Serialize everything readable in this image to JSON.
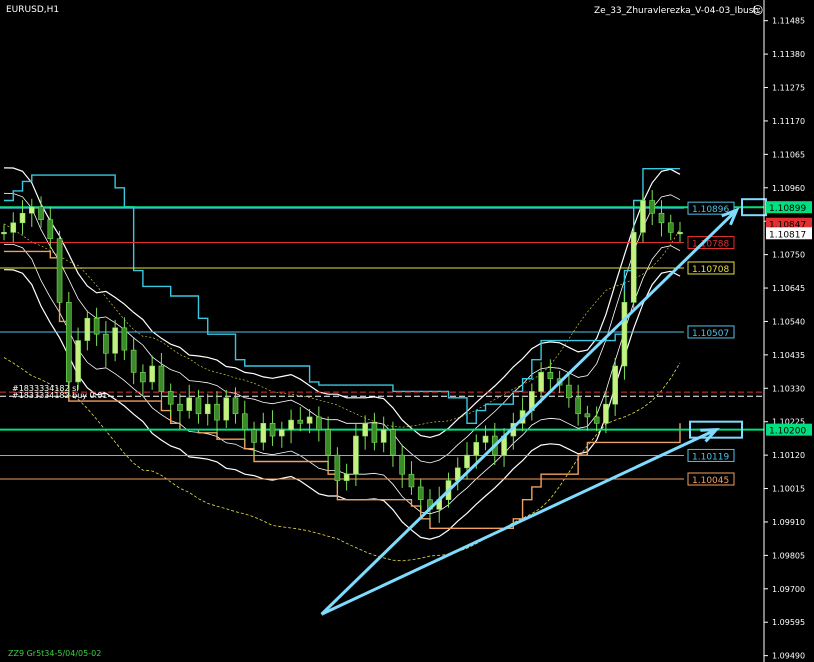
{
  "chart_data": {
    "type": "candlestick",
    "symbol": "EURUSD,H1",
    "indicator": "Ze_33_Zhuravlerezka_V-04-03_Ibush",
    "order_labels": [
      "#1833334182 sl",
      "#1833334182 buy 0.01"
    ],
    "bottom_text": "ZZ9 Gr5t34-5/04/05-02",
    "y_range": [
      1.0947,
      1.1155
    ],
    "y_ticks": [
      "1.11485",
      "1.11380",
      "1.11275",
      "1.11170",
      "1.11065",
      "1.10960",
      "1.10855",
      "1.10750",
      "1.10645",
      "1.10540",
      "1.10435",
      "1.10330",
      "1.10225",
      "1.10120",
      "1.10015",
      "1.09910",
      "1.09805",
      "1.09700",
      "1.09595",
      "1.09490"
    ],
    "levels": [
      {
        "label": "1.10899",
        "value": 1.10899,
        "color": "#00e080",
        "role": "tag"
      },
      {
        "label": "1.10896",
        "value": 1.10896,
        "color": "#4fc3e8",
        "role": "level"
      },
      {
        "label": "1.10847",
        "value": 1.10847,
        "color": "#e03030",
        "role": "tag"
      },
      {
        "label": "1.10817",
        "value": 1.10817,
        "color": "#ffffff",
        "role": "tag"
      },
      {
        "label": "1.10788",
        "value": 1.10788,
        "color": "#e03030",
        "role": "level"
      },
      {
        "label": "1.10708",
        "value": 1.10708,
        "color": "#e8e040",
        "role": "level"
      },
      {
        "label": "1.10507",
        "value": 1.10507,
        "color": "#4fc3e8",
        "role": "level"
      },
      {
        "label": "1.10200",
        "value": 1.102,
        "color": "#00e080",
        "role": "tag"
      },
      {
        "label": "1.10119",
        "value": 1.10119,
        "color": "#4fc3e8",
        "role": "level"
      },
      {
        "label": "1.10045",
        "value": 1.10045,
        "color": "#f0a060",
        "role": "level"
      }
    ],
    "close_series": [
      1.1082,
      1.1085,
      1.1088,
      1.109,
      1.1086,
      1.108,
      1.106,
      1.1035,
      1.1048,
      1.1055,
      1.105,
      1.1044,
      1.1052,
      1.1045,
      1.1038,
      1.1035,
      1.104,
      1.1032,
      1.1028,
      1.1026,
      1.103,
      1.1025,
      1.1028,
      1.1023,
      1.103,
      1.1025,
      1.102,
      1.1016,
      1.1022,
      1.1018,
      1.102,
      1.1023,
      1.1022,
      1.1024,
      1.102,
      1.1012,
      1.1004,
      1.1006,
      1.1018,
      1.1022,
      1.1016,
      1.102,
      1.1012,
      1.1006,
      1.1002,
      1.0998,
      1.0995,
      1.0998,
      1.1004,
      1.1008,
      1.1012,
      1.1016,
      1.1018,
      1.1012,
      1.1018,
      1.1022,
      1.1026,
      1.1032,
      1.1038,
      1.1036,
      1.1034,
      1.103,
      1.1025,
      1.1024,
      1.1022,
      1.1028,
      1.104,
      1.106,
      1.1082,
      1.1092,
      1.1088,
      1.1085,
      1.1082,
      1.1082
    ],
    "arrows": [
      {
        "from": [
          1.0962,
          0.395
        ],
        "to": [
          1.1089,
          0.905
        ]
      },
      {
        "from": [
          1.0962,
          0.395
        ],
        "to": [
          1.102,
          0.88
        ]
      }
    ]
  }
}
